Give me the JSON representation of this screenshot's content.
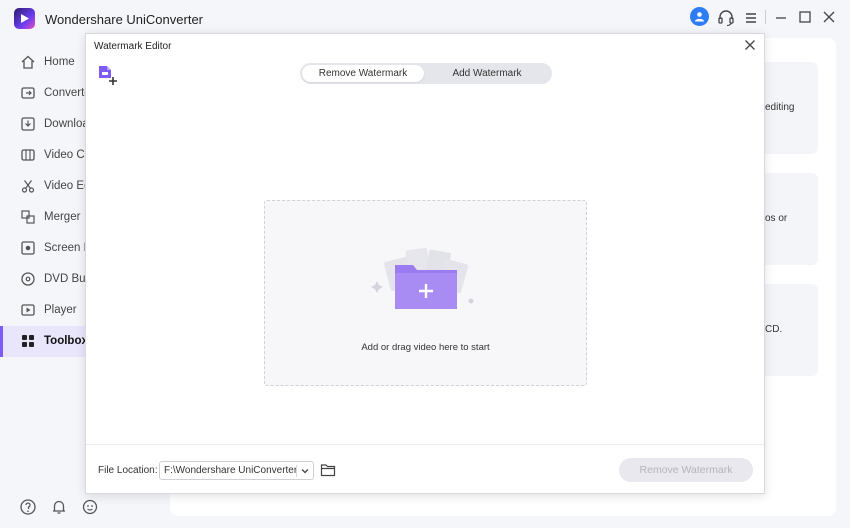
{
  "app": {
    "title": "Wondershare UniConverter"
  },
  "sidebar": {
    "items": [
      {
        "label": "Home",
        "icon": "home-icon"
      },
      {
        "label": "Converter",
        "icon": "converter-icon"
      },
      {
        "label": "Downloader",
        "icon": "download-icon"
      },
      {
        "label": "Video Compressor",
        "icon": "compress-icon"
      },
      {
        "label": "Video Editor",
        "icon": "scissors-icon"
      },
      {
        "label": "Merger",
        "icon": "merge-icon"
      },
      {
        "label": "Screen Recorder",
        "icon": "record-icon"
      },
      {
        "label": "DVD Burner",
        "icon": "disc-icon"
      },
      {
        "label": "Player",
        "icon": "play-icon"
      },
      {
        "label": "Toolbox",
        "icon": "grid-icon",
        "active": true
      }
    ]
  },
  "background_cards": [
    {
      "text": "editing"
    },
    {
      "text": "os or"
    },
    {
      "text": "CD."
    }
  ],
  "modal": {
    "title": "Watermark Editor",
    "tabs": [
      {
        "label": "Remove Watermark",
        "selected": true
      },
      {
        "label": "Add Watermark",
        "selected": false
      }
    ],
    "dropzone": {
      "text": "Add or drag video here to start"
    },
    "footer": {
      "file_location_label": "File Location:",
      "file_location_value": "F:\\Wondershare UniConverter",
      "action_button": "Remove Watermark",
      "action_enabled": false
    }
  },
  "colors": {
    "accent": "#7c5cf5",
    "user_badge": "#2f7df6",
    "folder": "#9b7cf0"
  }
}
